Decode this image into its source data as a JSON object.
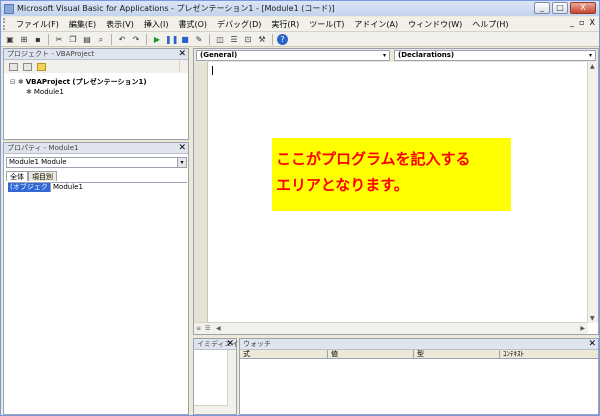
{
  "window": {
    "title": "Microsoft Visual Basic for Applications - プレゼンテーション1 - [Module1 (コード)]",
    "controls": [
      "_",
      "□",
      "X"
    ]
  },
  "menubar": {
    "items": [
      "ファイル(F)",
      "編集(E)",
      "表示(V)",
      "挿入(I)",
      "書式(O)",
      "デバッグ(D)",
      "実行(R)",
      "ツール(T)",
      "アドイン(A)",
      "ウィンドウ(W)",
      "ヘルプ(H)"
    ],
    "mdi_controls": [
      "_",
      "▫",
      "X"
    ]
  },
  "toolbar": {
    "buttons": [
      "view-app-icon",
      "insert-icon",
      "save-icon",
      "cut-icon",
      "copy-icon",
      "paste-icon",
      "find-icon",
      "undo-icon",
      "redo-icon",
      "run-icon",
      "break-icon",
      "reset-icon",
      "design-mode-icon",
      "project-explorer-icon",
      "properties-icon",
      "object-browser-icon",
      "toolbox-icon",
      "help-icon"
    ]
  },
  "project_panel": {
    "title": "プロジェクト - VBAProject",
    "tree": {
      "root": "VBAProject (プレゼンテーション1)",
      "child": "Module1"
    }
  },
  "properties_panel": {
    "title": "プロパティ - Module1",
    "object_selector": "Module1 Module",
    "tabs": [
      "全体",
      "項目別"
    ],
    "rows": [
      {
        "name": "(オブジェクト名)",
        "value": "Module1"
      }
    ]
  },
  "code_window": {
    "object_combo": "(General)",
    "procedure_combo": "(Declarations)"
  },
  "callout": {
    "line1": "ここがプログラムを記入する",
    "line2": "エリアとなります。"
  },
  "immediate_panel": {
    "title": "イミディエイト"
  },
  "watch_panel": {
    "title": "ウォッチ",
    "columns": [
      "式",
      "値",
      "型",
      "ｺﾝﾃｷｽﾄ"
    ]
  }
}
